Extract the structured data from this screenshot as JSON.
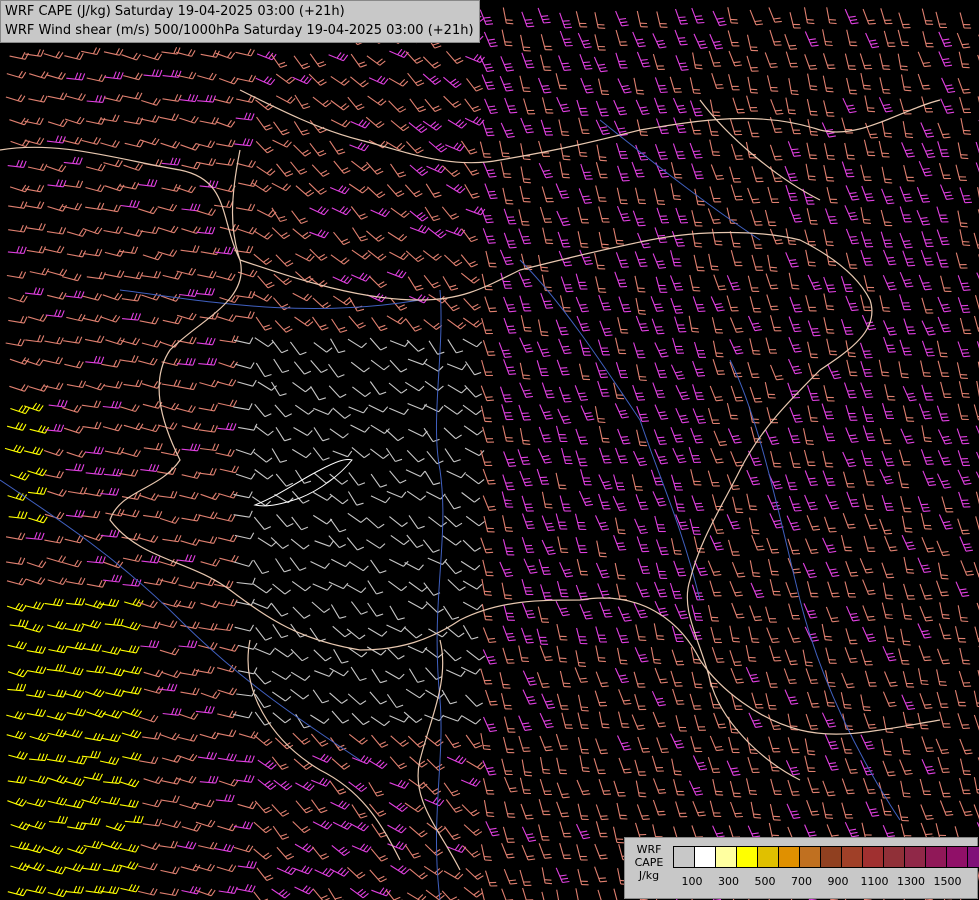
{
  "header": {
    "line1": "WRF CAPE (J/kg) Saturday 19-04-2025 03:00 (+21h)",
    "line2": "WRF Wind shear (m/s) 500/1000hPa Saturday 19-04-2025 03:00 (+21h)"
  },
  "legend": {
    "label_lines": [
      "WRF",
      "CAPE",
      "J/kg"
    ],
    "colors": [
      "#c8c8c8",
      "#ffffff",
      "#ffffa0",
      "#ffff00",
      "#e0c000",
      "#e09000",
      "#c07020",
      "#904020",
      "#a04028",
      "#a03030",
      "#903038",
      "#902848",
      "#901858",
      "#901068",
      "#801078",
      "#700070"
    ],
    "tick_labels": [
      "100",
      "300",
      "500",
      "700",
      "900",
      "1100",
      "1300",
      "1500"
    ]
  },
  "palette": {
    "low_shear": "#c8c8c8",
    "mid_shear": "#e08070",
    "high_shear": "#e040e0",
    "very_high_shear": "#ffff00",
    "borders": "#e8c8b0",
    "rivers": "#4060c0"
  }
}
